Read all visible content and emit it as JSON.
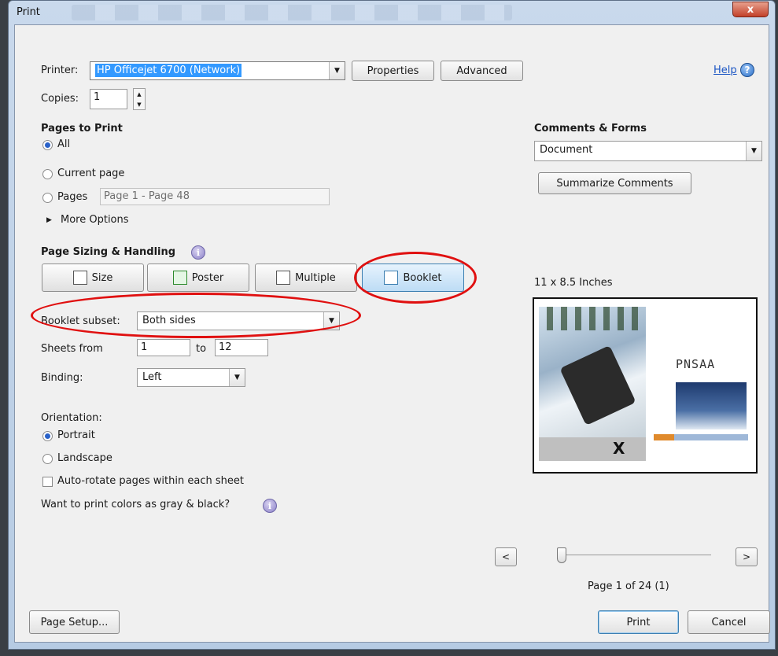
{
  "window": {
    "title": "Print",
    "close_label": "x"
  },
  "printer": {
    "label": "Printer:",
    "value": "HP Officejet 6700 (Network)",
    "properties_label": "Properties",
    "advanced_label": "Advanced"
  },
  "help": {
    "label": "Help",
    "icon": "question-icon"
  },
  "copies": {
    "label": "Copies:",
    "value": "1"
  },
  "pages_to_print": {
    "heading": "Pages to Print",
    "all_label": "All",
    "current_label": "Current page",
    "pages_label": "Pages",
    "pages_value": "Page 1 - Page 48",
    "more_options_label": "More Options",
    "selected": "All"
  },
  "page_sizing": {
    "heading": "Page Sizing & Handling",
    "buttons": [
      {
        "label": "Size",
        "icon": "size-icon"
      },
      {
        "label": "Poster",
        "icon": "poster-icon"
      },
      {
        "label": "Multiple",
        "icon": "multiple-icon"
      },
      {
        "label": "Booklet",
        "icon": "booklet-icon"
      }
    ],
    "active": "Booklet"
  },
  "booklet": {
    "subset_label": "Booklet subset:",
    "subset_value": "Both sides",
    "sheets_from_label": "Sheets from",
    "sheets_from_value": "1",
    "to_label": "to",
    "sheets_to_value": "12",
    "binding_label": "Binding:",
    "binding_value": "Left"
  },
  "orientation": {
    "heading": "Orientation:",
    "portrait_label": "Portrait",
    "landscape_label": "Landscape",
    "selected": "Portrait",
    "auto_rotate_label": "Auto-rotate pages within each sheet",
    "gray_label": "Want to print colors as gray & black?"
  },
  "comments_forms": {
    "heading": "Comments & Forms",
    "value": "Document",
    "summarize_label": "Summarize Comments"
  },
  "preview": {
    "size_label": "11 x 8.5 Inches",
    "logo_text": "PNSAA",
    "page_status": "Page 1 of 24 (1)",
    "prev_label": "<",
    "next_label": ">",
    "slider_position": 0
  },
  "footer": {
    "page_setup_label": "Page Setup...",
    "print_label": "Print",
    "cancel_label": "Cancel"
  },
  "colors": {
    "accent": "#2a62c9",
    "highlight_oval": "#e01010",
    "active_button": "#bddcf5",
    "printer_select_bg": "#3399ff"
  }
}
